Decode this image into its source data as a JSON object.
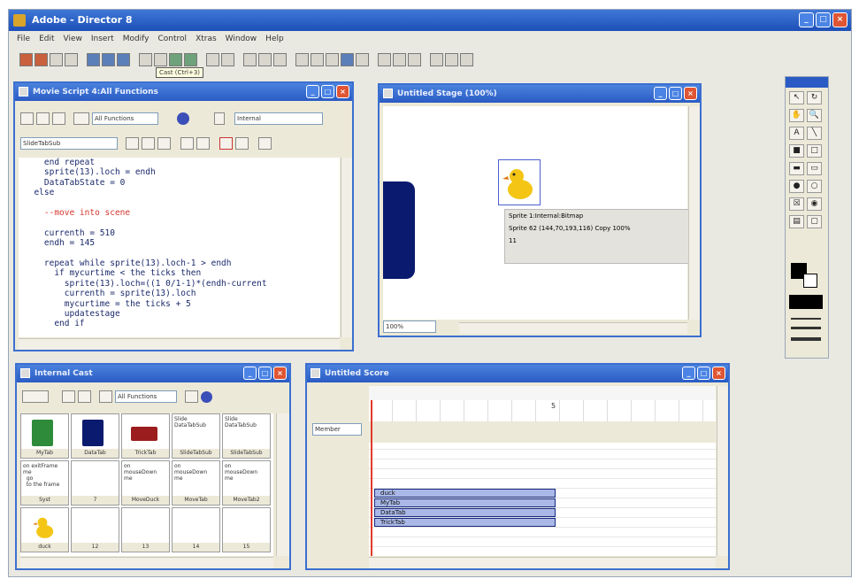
{
  "app": {
    "title": "Adobe - Director 8"
  },
  "menu": [
    "File",
    "Edit",
    "View",
    "Insert",
    "Modify",
    "Control",
    "Xtras",
    "Window",
    "Help"
  ],
  "tooltip": "Cast (Ctrl+3)",
  "script_window": {
    "title": "Movie Script 4:All Functions",
    "nav_select": "All Functions",
    "category_select": "Internal",
    "handler_select": "SlideTabSub",
    "code_lines": [
      {
        "text": "    end repeat",
        "cls": "kw"
      },
      {
        "text": "    sprite(13).loch = endh",
        "cls": "kw"
      },
      {
        "text": "    DataTabState = 0",
        "cls": "kw"
      },
      {
        "text": "  else",
        "cls": "kw"
      },
      {
        "text": "",
        "cls": ""
      },
      {
        "text": "    --move into scene",
        "cls": "com"
      },
      {
        "text": "",
        "cls": ""
      },
      {
        "text": "    currenth = 510",
        "cls": "kw"
      },
      {
        "text": "    endh = 145",
        "cls": "kw"
      },
      {
        "text": "",
        "cls": ""
      },
      {
        "text": "    repeat while sprite(13).loch-1 > endh",
        "cls": "kw"
      },
      {
        "text": "      if mycurtime < the ticks then",
        "cls": "kw"
      },
      {
        "text": "        sprite(13).loch=((1 0/1-1)*(endh-current",
        "cls": "kw"
      },
      {
        "text": "        currenth = sprite(13).loch",
        "cls": "kw"
      },
      {
        "text": "        mycurtime = the ticks + 5",
        "cls": "kw"
      },
      {
        "text": "        updatestage",
        "cls": "kw"
      },
      {
        "text": "      end if",
        "cls": "kw"
      }
    ]
  },
  "stage_window": {
    "title": "Untitled Stage (100%)",
    "zoom": "100%",
    "sprite_info": [
      "Sprite 1:Internal:Bitmap",
      "Sprite 62 (144,70,193,116) Copy 100%",
      "11"
    ]
  },
  "cast_window": {
    "title": "Internal Cast",
    "select": "All Functions",
    "members": [
      {
        "label": "MyTab",
        "kind": "green"
      },
      {
        "label": "DataTab",
        "kind": "navy"
      },
      {
        "label": "TrickTab",
        "kind": "red"
      },
      {
        "label": "SlideTabSub",
        "kind": "text",
        "text": "Slide\nDataTabSub"
      },
      {
        "label": "SlideTabSub",
        "kind": "text",
        "text": "Slide\nDataTabSub"
      },
      {
        "label": "Syst",
        "kind": "text",
        "text": "on exitFrame\nme\n  go\n  to the frame"
      },
      {
        "label": "7",
        "kind": "blank"
      },
      {
        "label": "MoveDuck",
        "kind": "text",
        "text": "on\nmouseDown\nme"
      },
      {
        "label": "MoveTab",
        "kind": "text",
        "text": "on\nmouseDown\nme"
      },
      {
        "label": "MoveTab2",
        "kind": "text",
        "text": "on\nmouseDown\nme"
      },
      {
        "label": "duck",
        "kind": "duck"
      },
      {
        "label": "12",
        "kind": "blank"
      },
      {
        "label": "13",
        "kind": "blank"
      },
      {
        "label": "14",
        "kind": "blank"
      },
      {
        "label": "15",
        "kind": "blank"
      }
    ]
  },
  "score_window": {
    "title": "Untitled Score",
    "channel_select": "Member",
    "frame_label": "5",
    "sprites": [
      "duck",
      "MyTab",
      "DataTab",
      "TrickTab"
    ]
  },
  "tool_palette": {
    "tools": [
      "arrow-tool",
      "rotate-tool",
      "hand-tool",
      "zoom-tool",
      "text-tool",
      "line-tool",
      "filled-rect-tool",
      "rect-tool",
      "filled-round-rect-tool",
      "round-rect-tool",
      "filled-ellipse-tool",
      "ellipse-tool",
      "checkbox-tool",
      "radio-tool",
      "field-tool",
      "button-tool"
    ]
  },
  "colors": {
    "titlebar": "#2a5bc4",
    "navy_sprite": "#0a1a6e",
    "sprite_bar": "#a9b8e6"
  }
}
